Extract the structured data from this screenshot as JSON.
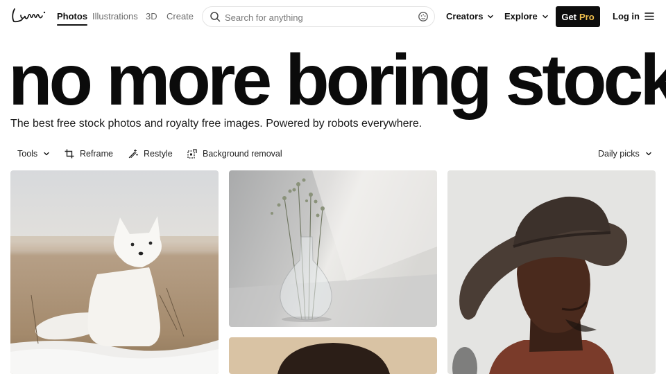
{
  "brand": {
    "logo_text": "Lummi"
  },
  "nav": {
    "tabs": [
      {
        "label": "Photos",
        "active": true
      },
      {
        "label": "Illustrations",
        "active": false
      },
      {
        "label": "3D",
        "active": false
      },
      {
        "label": "Create",
        "active": false
      }
    ],
    "search": {
      "placeholder": "Search for anything",
      "value": ""
    },
    "creators_label": "Creators",
    "explore_label": "Explore",
    "get_label": "Get",
    "pro_label": "Pro",
    "login_label": "Log in"
  },
  "hero": {
    "title": "no more boring stock",
    "subtitle": "The best free stock photos and royalty free images. Powered by robots everywhere."
  },
  "toolbar": {
    "tools_label": "Tools",
    "reframe_label": "Reframe",
    "restyle_label": "Restyle",
    "bg_removal_label": "Background removal",
    "sort_label": "Daily picks"
  },
  "photos": [
    {
      "subject": "arctic-fox-photo"
    },
    {
      "subject": "glass-vase-photo"
    },
    {
      "subject": "man-in-hat-photo"
    },
    {
      "subject": "portrait-photo"
    }
  ],
  "colors": {
    "text": "#111111",
    "muted": "#6b6b6b",
    "button_bg": "#0d0d0d",
    "pro_accent": "#f2c14e",
    "border": "#e4e4e4"
  }
}
